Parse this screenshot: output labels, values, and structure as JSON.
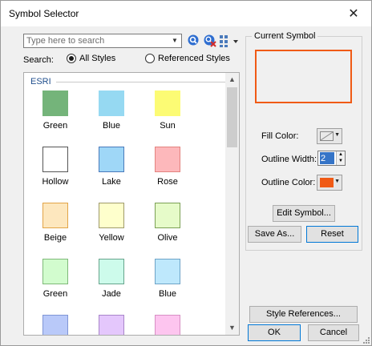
{
  "window": {
    "title": "Symbol Selector"
  },
  "search": {
    "placeholder": "Type here to search",
    "label": "Search:",
    "options": [
      {
        "label": "All Styles",
        "selected": true
      },
      {
        "label": "Referenced Styles",
        "selected": false
      }
    ]
  },
  "symbol_list": {
    "group": "ESRI",
    "items": [
      {
        "label": "Green",
        "fill": "#74b47a",
        "outline": "#74b47a"
      },
      {
        "label": "Blue",
        "fill": "#96d9f2",
        "outline": "#96d9f2"
      },
      {
        "label": "Sun",
        "fill": "#fcfb74",
        "outline": "#fcfb74"
      },
      {
        "label": "Hollow",
        "fill": "#ffffff",
        "outline": "#555555"
      },
      {
        "label": "Lake",
        "fill": "#9fd7f7",
        "outline": "#4a7abb"
      },
      {
        "label": "Rose",
        "fill": "#fdb8bb",
        "outline": "#e3837f"
      },
      {
        "label": "Beige",
        "fill": "#fde7be",
        "outline": "#e2a447"
      },
      {
        "label": "Yellow",
        "fill": "#feffcc",
        "outline": "#9f9a6a"
      },
      {
        "label": "Olive",
        "fill": "#e6fbc9",
        "outline": "#7ba055"
      },
      {
        "label": "Green",
        "fill": "#d2fcce",
        "outline": "#7eb978"
      },
      {
        "label": "Jade",
        "fill": "#cdfbeb",
        "outline": "#66a48c"
      },
      {
        "label": "Blue",
        "fill": "#bee8fc",
        "outline": "#6da3c7"
      },
      {
        "label": "",
        "fill": "#b9c9f9",
        "outline": "#7f95d5"
      },
      {
        "label": "",
        "fill": "#e4c7fc",
        "outline": "#a885c9"
      },
      {
        "label": "",
        "fill": "#fdc5ef",
        "outline": "#d78fc4"
      }
    ]
  },
  "current_symbol": {
    "title": "Current Symbol",
    "fill_color_label": "Fill Color:",
    "outline_width_label": "Outline Width:",
    "outline_width_value": "2",
    "outline_color_label": "Outline Color:",
    "outline_color": "#f05a15",
    "edit_symbol_label": "Edit Symbol...",
    "save_as_label": "Save As...",
    "reset_label": "Reset"
  },
  "footer": {
    "style_references_label": "Style References...",
    "ok_label": "OK",
    "cancel_label": "Cancel"
  }
}
